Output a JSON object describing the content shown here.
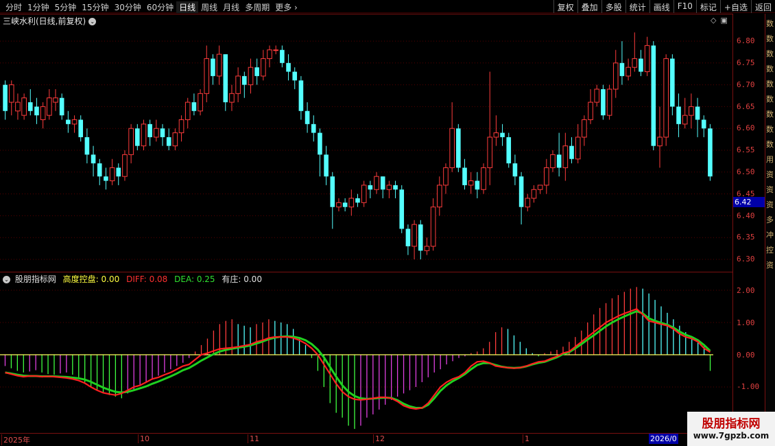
{
  "toolbar": {
    "periods": [
      "分时",
      "1分钟",
      "5分钟",
      "15分钟",
      "30分钟",
      "60分钟",
      "日线",
      "周线",
      "月线",
      "多周期",
      "更多"
    ],
    "active_period": "日线",
    "more_chevron": "›",
    "buttons": [
      "复权",
      "叠加",
      "多股",
      "统计",
      "画线",
      "F10",
      "标记",
      "+自选",
      "返回"
    ]
  },
  "main_chart": {
    "title": "三峡水利(日线,前复权)",
    "title_icon": "chevron-down-icon",
    "corner_icons": [
      "diamond-icon",
      "window-icon"
    ],
    "current_price_tag": "6.42",
    "y_ticks": [
      "6.80",
      "6.75",
      "6.70",
      "6.65",
      "6.60",
      "6.55",
      "6.50",
      "6.45",
      "6.40",
      "6.35",
      "6.30"
    ]
  },
  "sub_chart": {
    "legend_name": "股朋指标网",
    "items": [
      {
        "label": "高度控盘: 0.00",
        "color": "#ffff40"
      },
      {
        "label": "DIFF: 0.08",
        "color": "#ff3030"
      },
      {
        "label": "DEA: 0.25",
        "color": "#30e030"
      },
      {
        "label": "有庄: 0.00",
        "color": "#e0e0e0"
      }
    ],
    "y_ticks": [
      "2.00",
      "1.00",
      "0.00",
      "-1.00"
    ]
  },
  "date_axis": {
    "labels": [
      "2025年",
      "10",
      "11",
      "12",
      "1"
    ],
    "cursor_date": "2026/0"
  },
  "right_strip": "数数数数数数数数数用资资资多冲控资",
  "watermark": {
    "title": "股朋指标网",
    "url": "www.7gpzb.com"
  },
  "colors": {
    "up": "#ff3c3c",
    "down": "#54ffff",
    "diff": "#ff2020",
    "dea": "#20d020",
    "macd_pos_up": "#ff3c3c",
    "macd_pos_down": "#54ffff",
    "macd_neg_a": "#40ff40",
    "macd_neg_b": "#e040e0"
  },
  "chart_data": {
    "type": "candlestick",
    "price_axis": {
      "min": 6.3,
      "max": 6.8
    },
    "candles": [
      [
        6.7,
        6.64,
        6.71,
        6.62
      ],
      [
        6.66,
        6.7,
        6.71,
        6.63
      ],
      [
        6.64,
        6.66,
        6.68,
        6.62
      ],
      [
        6.63,
        6.67,
        6.68,
        6.62
      ],
      [
        6.66,
        6.64,
        6.69,
        6.63
      ],
      [
        6.65,
        6.63,
        6.67,
        6.61
      ],
      [
        6.62,
        6.65,
        6.66,
        6.6
      ],
      [
        6.63,
        6.67,
        6.69,
        6.62
      ],
      [
        6.66,
        6.67,
        6.69,
        6.64
      ],
      [
        6.67,
        6.63,
        6.68,
        6.62
      ],
      [
        6.62,
        6.61,
        6.64,
        6.59
      ],
      [
        6.61,
        6.62,
        6.63,
        6.59
      ],
      [
        6.62,
        6.58,
        6.63,
        6.57
      ],
      [
        6.58,
        6.54,
        6.6,
        6.52
      ],
      [
        6.54,
        6.52,
        6.56,
        6.49
      ],
      [
        6.52,
        6.49,
        6.53,
        6.47
      ],
      [
        6.49,
        6.48,
        6.51,
        6.46
      ],
      [
        6.48,
        6.51,
        6.53,
        6.47
      ],
      [
        6.51,
        6.49,
        6.52,
        6.47
      ],
      [
        6.49,
        6.54,
        6.55,
        6.48
      ],
      [
        6.54,
        6.6,
        6.61,
        6.52
      ],
      [
        6.6,
        6.56,
        6.61,
        6.55
      ],
      [
        6.56,
        6.61,
        6.62,
        6.55
      ],
      [
        6.61,
        6.58,
        6.62,
        6.56
      ],
      [
        6.58,
        6.6,
        6.62,
        6.57
      ],
      [
        6.6,
        6.58,
        6.61,
        6.56
      ],
      [
        6.58,
        6.56,
        6.6,
        6.55
      ],
      [
        6.56,
        6.59,
        6.6,
        6.55
      ],
      [
        6.59,
        6.62,
        6.63,
        6.57
      ],
      [
        6.62,
        6.66,
        6.67,
        6.6
      ],
      [
        6.66,
        6.64,
        6.68,
        6.63
      ],
      [
        6.64,
        6.68,
        6.69,
        6.63
      ],
      [
        6.68,
        6.76,
        6.79,
        6.66
      ],
      [
        6.76,
        6.72,
        6.77,
        6.7
      ],
      [
        6.72,
        6.77,
        6.79,
        6.7
      ],
      [
        6.77,
        6.66,
        6.77,
        6.64
      ],
      [
        6.66,
        6.68,
        6.7,
        6.64
      ],
      [
        6.68,
        6.72,
        6.74,
        6.66
      ],
      [
        6.72,
        6.7,
        6.73,
        6.67
      ],
      [
        6.7,
        6.74,
        6.76,
        6.68
      ],
      [
        6.74,
        6.72,
        6.76,
        6.7
      ],
      [
        6.72,
        6.76,
        6.78,
        6.71
      ],
      [
        6.76,
        6.78,
        6.79,
        6.74
      ],
      [
        6.78,
        6.78,
        6.79,
        6.77
      ],
      [
        6.78,
        6.75,
        6.79,
        6.74
      ],
      [
        6.75,
        6.73,
        6.77,
        6.71
      ],
      [
        6.73,
        6.71,
        6.74,
        6.69
      ],
      [
        6.71,
        6.64,
        6.72,
        6.62
      ],
      [
        6.64,
        6.61,
        6.66,
        6.59
      ],
      [
        6.61,
        6.59,
        6.63,
        6.57
      ],
      [
        6.59,
        6.54,
        6.6,
        6.49
      ],
      [
        6.54,
        6.49,
        6.56,
        6.47
      ],
      [
        6.49,
        6.42,
        6.5,
        6.37
      ],
      [
        6.42,
        6.43,
        6.44,
        6.41
      ],
      [
        6.43,
        6.42,
        6.44,
        6.41
      ],
      [
        6.42,
        6.44,
        6.46,
        6.4
      ],
      [
        6.44,
        6.43,
        6.45,
        6.42
      ],
      [
        6.43,
        6.47,
        6.48,
        6.42
      ],
      [
        6.47,
        6.46,
        6.48,
        6.44
      ],
      [
        6.46,
        6.49,
        6.5,
        6.45
      ],
      [
        6.49,
        6.46,
        6.49,
        6.44
      ],
      [
        6.46,
        6.47,
        6.48,
        6.44
      ],
      [
        6.47,
        6.46,
        6.48,
        6.44
      ],
      [
        6.46,
        6.37,
        6.47,
        6.36
      ],
      [
        6.37,
        6.33,
        6.38,
        6.31
      ],
      [
        6.33,
        6.38,
        6.39,
        6.3
      ],
      [
        6.38,
        6.32,
        6.39,
        6.3
      ],
      [
        6.32,
        6.33,
        6.35,
        6.31
      ],
      [
        6.33,
        6.42,
        6.44,
        6.32
      ],
      [
        6.42,
        6.47,
        6.49,
        6.4
      ],
      [
        6.47,
        6.51,
        6.52,
        6.45
      ],
      [
        6.51,
        6.6,
        6.66,
        6.5
      ],
      [
        6.6,
        6.51,
        6.61,
        6.5
      ],
      [
        6.51,
        6.47,
        6.53,
        6.46
      ],
      [
        6.47,
        6.48,
        6.5,
        6.45
      ],
      [
        6.48,
        6.46,
        6.5,
        6.44
      ],
      [
        6.46,
        6.51,
        6.52,
        6.45
      ],
      [
        6.51,
        6.58,
        6.73,
        6.47
      ],
      [
        6.58,
        6.59,
        6.63,
        6.56
      ],
      [
        6.59,
        6.58,
        6.61,
        6.56
      ],
      [
        6.58,
        6.52,
        6.59,
        6.51
      ],
      [
        6.52,
        6.49,
        6.54,
        6.47
      ],
      [
        6.49,
        6.42,
        6.5,
        6.38
      ],
      [
        6.42,
        6.44,
        6.45,
        6.41
      ],
      [
        6.44,
        6.46,
        6.47,
        6.43
      ],
      [
        6.46,
        6.47,
        6.47,
        6.45
      ],
      [
        6.47,
        6.51,
        6.53,
        6.45
      ],
      [
        6.51,
        6.54,
        6.55,
        6.5
      ],
      [
        6.54,
        6.51,
        6.59,
        6.49
      ],
      [
        6.51,
        6.56,
        6.59,
        6.48
      ],
      [
        6.56,
        6.53,
        6.58,
        6.52
      ],
      [
        6.53,
        6.58,
        6.61,
        6.52
      ],
      [
        6.58,
        6.62,
        6.63,
        6.56
      ],
      [
        6.62,
        6.66,
        6.69,
        6.61
      ],
      [
        6.66,
        6.69,
        6.7,
        6.65
      ],
      [
        6.69,
        6.63,
        6.7,
        6.62
      ],
      [
        6.63,
        6.69,
        6.7,
        6.62
      ],
      [
        6.69,
        6.75,
        6.78,
        6.67
      ],
      [
        6.75,
        6.72,
        6.8,
        6.7
      ],
      [
        6.72,
        6.74,
        6.76,
        6.71
      ],
      [
        6.74,
        6.76,
        6.82,
        6.73
      ],
      [
        6.76,
        6.73,
        6.78,
        6.72
      ],
      [
        6.73,
        6.79,
        6.81,
        6.72
      ],
      [
        6.79,
        6.56,
        6.8,
        6.55
      ],
      [
        6.56,
        6.58,
        6.65,
        6.51
      ],
      [
        6.58,
        6.76,
        6.77,
        6.56
      ],
      [
        6.76,
        6.65,
        6.77,
        6.63
      ],
      [
        6.65,
        6.61,
        6.68,
        6.58
      ],
      [
        6.61,
        6.63,
        6.67,
        6.6
      ],
      [
        6.63,
        6.65,
        6.68,
        6.6
      ],
      [
        6.65,
        6.62,
        6.67,
        6.58
      ],
      [
        6.62,
        6.6,
        6.63,
        6.58
      ],
      [
        6.6,
        6.49,
        6.61,
        6.48
      ]
    ],
    "macd_hist": [
      -0.35,
      -0.42,
      -0.5,
      -0.55,
      -0.52,
      -0.48,
      -0.55,
      -0.6,
      -0.62,
      -0.58,
      -0.55,
      -0.62,
      -0.7,
      -0.85,
      -1.0,
      -1.1,
      -1.2,
      -1.25,
      -1.3,
      -1.35,
      -1.2,
      -1.1,
      -0.95,
      -0.85,
      -0.75,
      -0.65,
      -0.55,
      -0.45,
      -0.35,
      -0.25,
      -0.1,
      0.1,
      0.3,
      0.5,
      0.75,
      0.95,
      1.05,
      1.1,
      0.95,
      0.9,
      0.85,
      0.95,
      1.0,
      1.1,
      1.05,
      1.0,
      0.95,
      0.8,
      0.55,
      0.3,
      -0.1,
      -0.5,
      -1.0,
      -1.5,
      -1.8,
      -1.95,
      -2.2,
      -2.3,
      -2.2,
      -1.95,
      -1.85,
      -1.7,
      -1.55,
      -1.4,
      -1.3,
      -1.2,
      -1.1,
      -1.0,
      -0.85,
      -0.7,
      -0.55,
      -0.45,
      -0.3,
      -0.2,
      -0.1,
      -0.05,
      0.05,
      0.1,
      0.2,
      0.4,
      0.7,
      0.85,
      0.8,
      0.6,
      0.4,
      0.2,
      0.05,
      -0.05,
      0.05,
      0.1,
      0.15,
      0.25,
      0.4,
      0.55,
      0.75,
      1.0,
      1.25,
      1.45,
      1.6,
      1.75,
      1.85,
      1.95,
      2.05,
      2.1,
      2.05,
      1.9,
      1.7,
      1.5,
      1.3,
      1.1,
      0.9,
      0.7,
      0.55,
      0.4,
      0.25,
      -0.5
    ],
    "diff": [
      -0.55,
      -0.6,
      -0.65,
      -0.68,
      -0.66,
      -0.66,
      -0.68,
      -0.67,
      -0.68,
      -0.7,
      -0.72,
      -0.75,
      -0.8,
      -0.88,
      -1.0,
      -1.1,
      -1.18,
      -1.22,
      -1.25,
      -1.2,
      -1.1,
      -1.0,
      -0.95,
      -0.85,
      -0.75,
      -0.7,
      -0.62,
      -0.55,
      -0.45,
      -0.35,
      -0.3,
      -0.15,
      0.0,
      0.05,
      0.12,
      0.18,
      0.2,
      0.22,
      0.25,
      0.28,
      0.32,
      0.4,
      0.45,
      0.52,
      0.55,
      0.55,
      0.55,
      0.52,
      0.45,
      0.35,
      0.2,
      0.0,
      -0.3,
      -0.6,
      -0.9,
      -1.15,
      -1.3,
      -1.38,
      -1.4,
      -1.38,
      -1.35,
      -1.32,
      -1.32,
      -1.35,
      -1.45,
      -1.58,
      -1.65,
      -1.68,
      -1.65,
      -1.5,
      -1.25,
      -1.0,
      -0.85,
      -0.75,
      -0.68,
      -0.55,
      -0.35,
      -0.22,
      -0.2,
      -0.25,
      -0.35,
      -0.38,
      -0.4,
      -0.42,
      -0.4,
      -0.35,
      -0.28,
      -0.22,
      -0.2,
      -0.12,
      -0.05,
      0.05,
      0.1,
      0.25,
      0.4,
      0.55,
      0.7,
      0.85,
      1.0,
      1.1,
      1.2,
      1.28,
      1.35,
      1.42,
      1.25,
      1.05,
      1.0,
      0.95,
      0.9,
      0.8,
      0.65,
      0.55,
      0.5,
      0.4,
      0.2,
      0.08
    ],
    "dea": [
      -0.55,
      -0.58,
      -0.62,
      -0.65,
      -0.66,
      -0.66,
      -0.67,
      -0.67,
      -0.67,
      -0.68,
      -0.69,
      -0.71,
      -0.73,
      -0.77,
      -0.84,
      -0.93,
      -1.02,
      -1.09,
      -1.15,
      -1.17,
      -1.15,
      -1.1,
      -1.04,
      -0.98,
      -0.9,
      -0.83,
      -0.75,
      -0.67,
      -0.58,
      -0.48,
      -0.41,
      -0.3,
      -0.18,
      -0.08,
      0.02,
      0.1,
      0.15,
      0.19,
      0.22,
      0.25,
      0.29,
      0.35,
      0.41,
      0.48,
      0.53,
      0.56,
      0.57,
      0.56,
      0.52,
      0.45,
      0.33,
      0.16,
      -0.08,
      -0.38,
      -0.68,
      -0.95,
      -1.15,
      -1.28,
      -1.35,
      -1.37,
      -1.36,
      -1.34,
      -1.33,
      -1.34,
      -1.41,
      -1.52,
      -1.6,
      -1.65,
      -1.65,
      -1.55,
      -1.35,
      -1.12,
      -0.95,
      -0.82,
      -0.72,
      -0.6,
      -0.45,
      -0.32,
      -0.26,
      -0.26,
      -0.32,
      -0.37,
      -0.4,
      -0.41,
      -0.4,
      -0.36,
      -0.3,
      -0.25,
      -0.22,
      -0.15,
      -0.08,
      0.02,
      0.08,
      0.2,
      0.33,
      0.47,
      0.6,
      0.74,
      0.88,
      1.0,
      1.1,
      1.19,
      1.27,
      1.35,
      1.28,
      1.13,
      1.05,
      0.99,
      0.93,
      0.84,
      0.72,
      0.62,
      0.55,
      0.45,
      0.3,
      0.12
    ],
    "macd_axis": {
      "min": -2.3,
      "max": 2.3
    }
  }
}
